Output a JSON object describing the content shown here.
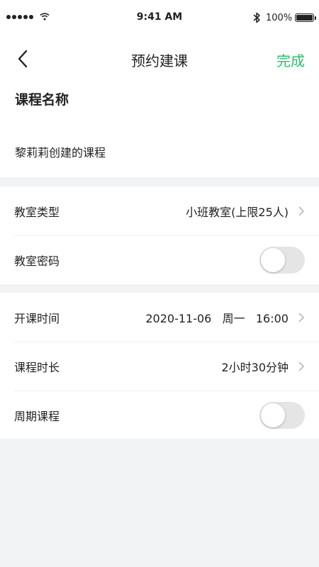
{
  "status_bar": {
    "time": "9:41 AM",
    "battery": "100%",
    "icons": [
      "signal-dots-icon",
      "wifi-icon",
      "bluetooth-icon",
      "battery-icon"
    ]
  },
  "nav": {
    "title": "预约建课",
    "done_label": "完成",
    "back_icon": "chevron-left-icon",
    "accent_color": "#2dbd6c"
  },
  "course": {
    "heading": "课程名称",
    "name_value": "黎莉莉创建的课程"
  },
  "classroom": {
    "type_label": "教室类型",
    "type_value": "小班教室(上限25人)",
    "password_label": "教室密码",
    "password_enabled": false
  },
  "schedule": {
    "start_label": "开课时间",
    "start_value": "2020-11-06   周一   16:00",
    "duration_label": "课程时长",
    "duration_value": "2小时30分钟",
    "recurring_label": "周期课程",
    "recurring_enabled": false
  }
}
